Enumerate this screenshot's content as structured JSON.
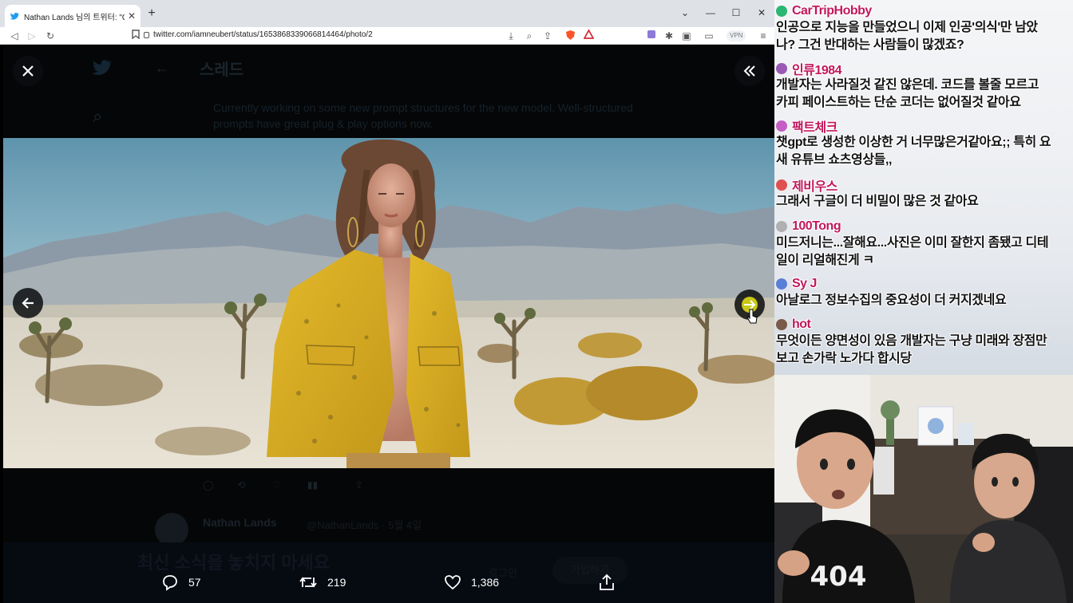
{
  "browser": {
    "tab_title": "Nathan Lands 님의 트위터: \"Only",
    "url": "twitter.com/iamneubert/status/1653868339066814464/photo/2",
    "vpn_label": "VPN"
  },
  "background_page": {
    "thread_title": "스레드",
    "tweet_text": "Currently working on some new prompt structures for the new model. Well-structured prompts have great plug & play options now.",
    "reply_author": "Nathan Lands",
    "reply_handle": "@NathanLands · 5월 4일",
    "promo_text": "최신 소식을 놓치지 마세요",
    "login_label": "로그인",
    "signup_label": "가입하기"
  },
  "viewer": {
    "colors": {
      "accent_next": "#c8c816",
      "overlay": "#0c0e10"
    }
  },
  "actions": {
    "replies": "57",
    "retweets": "219",
    "likes": "1,386"
  },
  "chat": {
    "messages": [
      {
        "name": "CarTripHobby",
        "avatar_color": "#2bb673",
        "lines": [
          "인공으로 지능을 만들었으니 이제 인공'의식'만 남았",
          "나? 그건 반대하는 사람들이 많겠죠?"
        ]
      },
      {
        "name": "인류1984",
        "avatar_color": "#9b59b6",
        "lines": [
          "개발자는 사라질것 같진 않은데. 코드를 볼줄 모르고",
          "카피 페이스트하는 단순 코더는 없어질것 같아요"
        ]
      },
      {
        "name": "팩트체크",
        "avatar_color": "#c45fc4",
        "lines": [
          "챗gpt로 생성한 이상한 거 너무많은거같아요;; 특히 요",
          "새 유튜브 쇼츠영상들,,"
        ]
      },
      {
        "name": "제비우스",
        "avatar_color": "#e05050",
        "lines": [
          "그래서 구글이 더 비밀이 많은 것 같아요"
        ]
      },
      {
        "name": "100Tong",
        "avatar_color": "#b0b0b0",
        "lines": [
          "미드저니는...잘해요...사진은 이미 잘한지 좀됐고 디테",
          "일이 리얼해진게 ㅋ"
        ]
      },
      {
        "name": "Sy J",
        "avatar_color": "#5a7fd6",
        "lines": [
          "아날로그 정보수집의 중요성이 더 커지겠네요"
        ]
      },
      {
        "name": "hot",
        "avatar_color": "#7a5a48",
        "lines": [
          "무엇이든 양면성이 있음 개발자는 구냥 미래와 장점만",
          "보고 손가락 노가다 합시당"
        ]
      }
    ]
  },
  "webcam": {
    "shirt_text": "404"
  }
}
